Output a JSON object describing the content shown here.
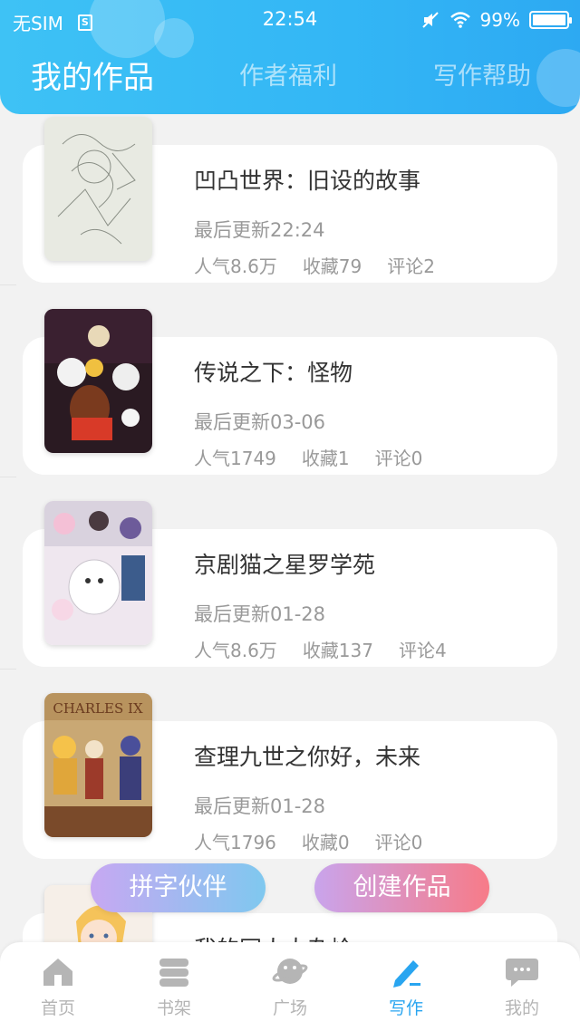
{
  "status_bar": {
    "carrier": "无SIM",
    "sim_glyph": "S",
    "time": "22:54",
    "battery": "99%",
    "battery_level": 0.99
  },
  "tabs": [
    {
      "label": "我的作品",
      "active": true
    },
    {
      "label": "作者福利",
      "active": false
    },
    {
      "label": "写作帮助",
      "active": false
    }
  ],
  "works": [
    {
      "title": "凹凸世界：旧设的故事",
      "updated": "最后更新22:24",
      "popularity": "人气8.6万",
      "favorites": "收藏79",
      "comments": "评论2"
    },
    {
      "title": "传说之下：怪物",
      "updated": "最后更新03-06",
      "popularity": "人气1749",
      "favorites": "收藏1",
      "comments": "评论0"
    },
    {
      "title": "京剧猫之星罗学苑",
      "updated": "最后更新01-28",
      "popularity": "人气8.6万",
      "favorites": "收藏137",
      "comments": "评论4"
    },
    {
      "title": "查理九世之你好，未来",
      "updated": "最后更新01-28",
      "popularity": "人气1796",
      "favorites": "收藏0",
      "comments": "评论0",
      "cover_text": "CHARLES IX"
    },
    {
      "title": "我的同人大杂烩",
      "updated": "",
      "popularity": "",
      "favorites": "",
      "comments": ""
    }
  ],
  "actions": {
    "partner_label": "拼字伙伴",
    "create_label": "创建作品"
  },
  "bottom_nav": [
    {
      "label": "首页",
      "icon": "home-icon",
      "active": false
    },
    {
      "label": "书架",
      "icon": "bookshelf-icon",
      "active": false
    },
    {
      "label": "广场",
      "icon": "planet-icon",
      "active": false
    },
    {
      "label": "写作",
      "icon": "pen-icon",
      "active": true
    },
    {
      "label": "我的",
      "icon": "chat-bubble-icon",
      "active": false
    }
  ],
  "colors": {
    "header_blue": "#33b6f5",
    "active_nav": "#29a5f0",
    "inactive_nav": "#b5b5b5"
  }
}
